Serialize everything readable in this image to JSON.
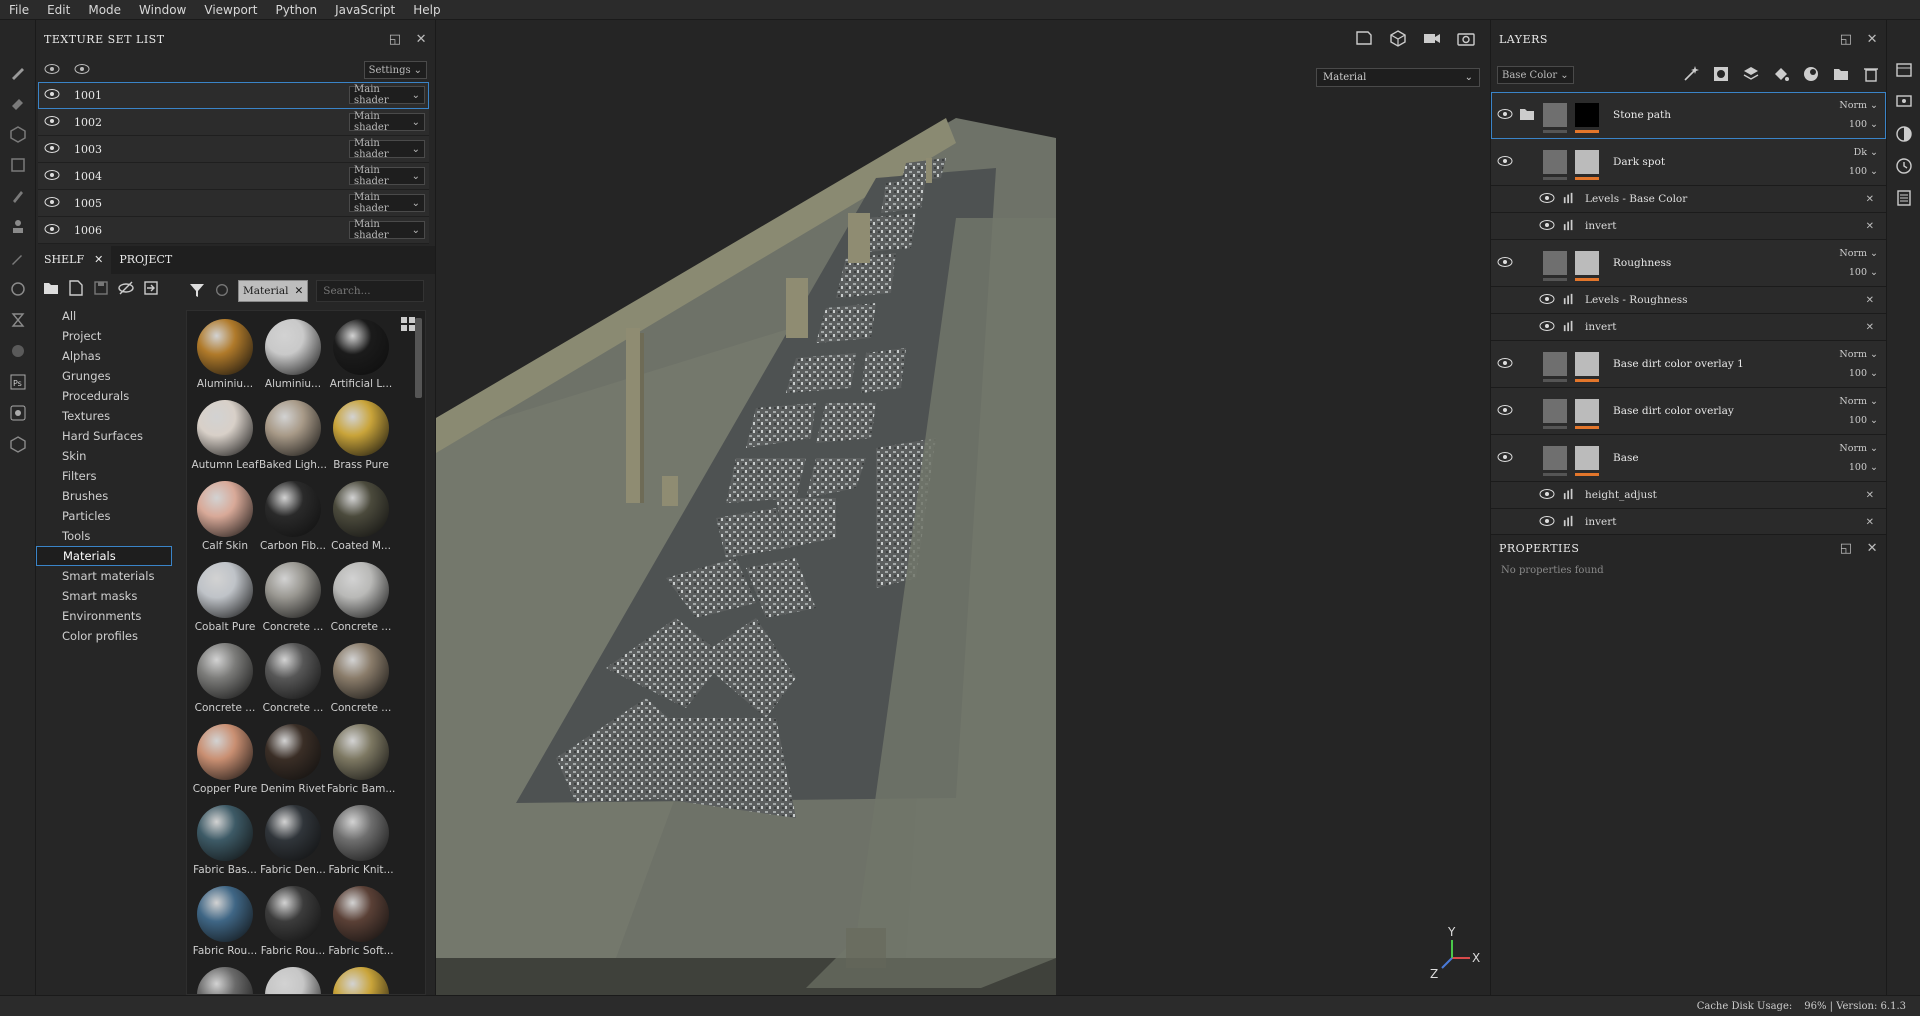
{
  "menu": [
    "File",
    "Edit",
    "Mode",
    "Window",
    "Viewport",
    "Python",
    "JavaScript",
    "Help"
  ],
  "texture_set_list": {
    "title": "TEXTURE SET LIST",
    "settings_label": "Settings",
    "rows": [
      {
        "name": "1001",
        "shader": "Main shader"
      },
      {
        "name": "1002",
        "shader": "Main shader"
      },
      {
        "name": "1003",
        "shader": "Main shader"
      },
      {
        "name": "1004",
        "shader": "Main shader"
      },
      {
        "name": "1005",
        "shader": "Main shader"
      },
      {
        "name": "1006",
        "shader": "Main shader"
      }
    ]
  },
  "shelf": {
    "tabs": [
      "SHELF",
      "PROJECT"
    ],
    "categories": [
      "All",
      "Project",
      "Alphas",
      "Grunges",
      "Procedurals",
      "Textures",
      "Hard Surfaces",
      "Skin",
      "Filters",
      "Brushes",
      "Particles",
      "Tools",
      "Materials",
      "Smart materials",
      "Smart masks",
      "Environments",
      "Color profiles"
    ],
    "selected_category": "Materials",
    "filter_chip": "Material",
    "search_placeholder": "Search...",
    "materials": [
      {
        "label": "Aluminiu...",
        "color": "#b07a2a"
      },
      {
        "label": "Aluminiu...",
        "color": "#c9c9c9"
      },
      {
        "label": "Artificial L...",
        "color": "#1b1b1b"
      },
      {
        "label": "Autumn Leaf",
        "color": "#d8d0c8"
      },
      {
        "label": "Baked Ligh...",
        "color": "#a89a88"
      },
      {
        "label": "Brass Pure",
        "color": "#c9a43a"
      },
      {
        "label": "Calf Skin",
        "color": "#d8a998"
      },
      {
        "label": "Carbon Fib...",
        "color": "#2a2a2a"
      },
      {
        "label": "Coated M...",
        "color": "#4b4a3c"
      },
      {
        "label": "Cobalt Pure",
        "color": "#bfc3c8"
      },
      {
        "label": "Concrete ...",
        "color": "#9a9892"
      },
      {
        "label": "Concrete ...",
        "color": "#b9b9b7"
      },
      {
        "label": "Concrete ...",
        "color": "#7c7c7a"
      },
      {
        "label": "Concrete ...",
        "color": "#575757"
      },
      {
        "label": "Concrete ...",
        "color": "#8a7c6a"
      },
      {
        "label": "Copper Pure",
        "color": "#c98f72"
      },
      {
        "label": "Denim Rivet",
        "color": "#3a2e26"
      },
      {
        "label": "Fabric Bam...",
        "color": "#7d7862"
      },
      {
        "label": "Fabric Bas...",
        "color": "#3d5a66"
      },
      {
        "label": "Fabric Den...",
        "color": "#30353a"
      },
      {
        "label": "Fabric Knit...",
        "color": "#6e6e6e"
      },
      {
        "label": "Fabric Rou...",
        "color": "#3f6685"
      },
      {
        "label": "Fabric Rou...",
        "color": "#3c3c3c"
      },
      {
        "label": "Fabric Soft...",
        "color": "#5a4036"
      },
      {
        "label": "",
        "color": "#6a6a6a"
      },
      {
        "label": "",
        "color": "#c6c6c6"
      },
      {
        "label": "",
        "color": "#c9a43a"
      }
    ]
  },
  "viewport": {
    "mode_select": "Material",
    "axis": {
      "x": "X",
      "y": "Y",
      "z": "Z"
    }
  },
  "layers": {
    "title": "LAYERS",
    "channel_select": "Base Color",
    "rows": [
      {
        "name": "Stone path",
        "blend": "Norm",
        "opacity": "100",
        "kind": "folder"
      },
      {
        "name": "Dark spot",
        "blend": "Dk",
        "opacity": "100",
        "kind": "layer"
      },
      {
        "name": "Levels - Base Color",
        "kind": "effect"
      },
      {
        "name": "invert",
        "kind": "effect"
      },
      {
        "name": "Roughness",
        "blend": "Norm",
        "opacity": "100",
        "kind": "layer"
      },
      {
        "name": "Levels - Roughness",
        "kind": "effect"
      },
      {
        "name": "invert",
        "kind": "effect"
      },
      {
        "name": "Base dirt color overlay 1",
        "blend": "Norm",
        "opacity": "100",
        "kind": "layer"
      },
      {
        "name": "Base dirt color overlay",
        "blend": "Norm",
        "opacity": "100",
        "kind": "layer"
      },
      {
        "name": "Base",
        "blend": "Norm",
        "opacity": "100",
        "kind": "layer"
      },
      {
        "name": "height_adjust",
        "kind": "effect"
      },
      {
        "name": "invert",
        "kind": "effect"
      }
    ]
  },
  "properties": {
    "title": "PROPERTIES",
    "empty_text": "No properties found"
  },
  "status": {
    "cache": "Cache Disk Usage:",
    "version": "96% | Version: 6.1.3"
  },
  "colors": {
    "accent": "#3a84c8",
    "layer_bar": "#e3762b"
  }
}
